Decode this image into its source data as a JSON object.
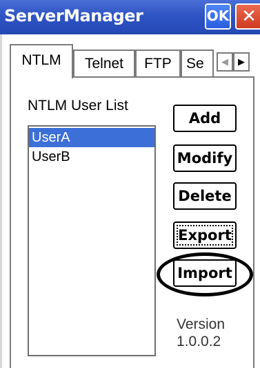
{
  "window": {
    "title": "ServerManager",
    "ok_label": "OK",
    "close_label": "✕"
  },
  "tabs": [
    {
      "label": "NTLM",
      "selected": true
    },
    {
      "label": "Telnet",
      "selected": false
    },
    {
      "label": "FTP",
      "selected": false
    },
    {
      "label": "Se",
      "selected": false
    }
  ],
  "tab_scroll": {
    "left_icon": "chevron-left-icon",
    "left_glyph": "◀",
    "right_icon": "chevron-right-icon",
    "right_glyph": "▶"
  },
  "ntlm": {
    "list_label": "NTLM User List",
    "users": [
      {
        "name": "UserA",
        "selected": true
      },
      {
        "name": "UserB",
        "selected": false
      }
    ],
    "buttons": {
      "add": "Add",
      "modify": "Modify",
      "delete": "Delete",
      "export": "Export",
      "import": "Import"
    },
    "version_label": "Version",
    "version_value": "1.0.0.2"
  },
  "colors": {
    "titlebar": "#2f54c4",
    "ok_button": "#2a5fe0",
    "close_button": "#cf3b21",
    "selection": "#3c6fd8"
  }
}
